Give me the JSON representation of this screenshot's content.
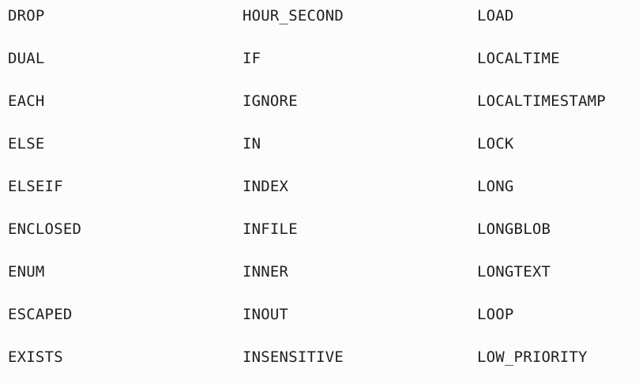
{
  "keywords": {
    "rows": [
      [
        "DROP",
        "HOUR_SECOND",
        "LOAD"
      ],
      [
        "DUAL",
        "IF",
        "LOCALTIME"
      ],
      [
        "EACH",
        "IGNORE",
        "LOCALTIMESTAMP"
      ],
      [
        "ELSE",
        "IN",
        "LOCK"
      ],
      [
        "ELSEIF",
        "INDEX",
        "LONG"
      ],
      [
        "ENCLOSED",
        "INFILE",
        "LONGBLOB"
      ],
      [
        "ENUM",
        "INNER",
        "LONGTEXT"
      ],
      [
        "ESCAPED",
        "INOUT",
        "LOOP"
      ],
      [
        "EXISTS",
        "INSENSITIVE",
        "LOW_PRIORITY"
      ]
    ]
  },
  "colors": {
    "background": "#fcfcfc",
    "text": "#1f1f1f"
  }
}
